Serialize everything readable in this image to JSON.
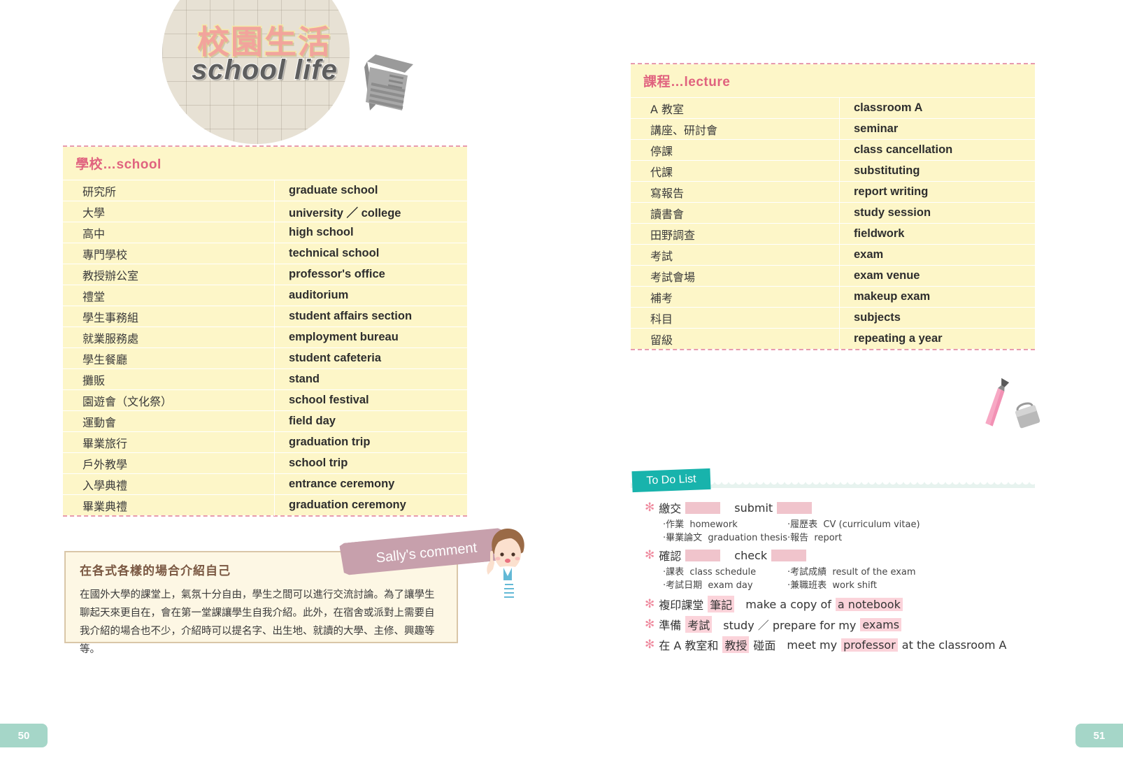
{
  "title": {
    "chinese": "校園生活",
    "english": "school life",
    "notebook_icon": "notebook-icon"
  },
  "tables": [
    {
      "id": "school",
      "title": "學校…school",
      "rows": [
        {
          "cn": "研究所",
          "en": "graduate school"
        },
        {
          "cn": "大學",
          "en": "university ／ college"
        },
        {
          "cn": "高中",
          "en": "high school"
        },
        {
          "cn": "專門學校",
          "en": "technical school"
        },
        {
          "cn": "教授辦公室",
          "en": "professor's office"
        },
        {
          "cn": "禮堂",
          "en": "auditorium"
        },
        {
          "cn": "學生事務組",
          "en": "student affairs section"
        },
        {
          "cn": "就業服務處",
          "en": "employment bureau"
        },
        {
          "cn": "學生餐廳",
          "en": "student cafeteria"
        },
        {
          "cn": "攤販",
          "en": "stand"
        },
        {
          "cn": "園遊會（文化祭）",
          "en": "school festival"
        },
        {
          "cn": "運動會",
          "en": "field day"
        },
        {
          "cn": "畢業旅行",
          "en": "graduation trip"
        },
        {
          "cn": "戶外教學",
          "en": "school trip"
        },
        {
          "cn": "入學典禮",
          "en": "entrance ceremony"
        },
        {
          "cn": "畢業典禮",
          "en": "graduation ceremony"
        }
      ]
    },
    {
      "id": "lecture",
      "title": "課程…lecture",
      "rows": [
        {
          "cn": "A 教室",
          "en": "classroom A"
        },
        {
          "cn": "講座、研討會",
          "en": "seminar"
        },
        {
          "cn": "停課",
          "en": "class cancellation"
        },
        {
          "cn": "代課",
          "en": "substituting"
        },
        {
          "cn": "寫報告",
          "en": "report writing"
        },
        {
          "cn": "讀書會",
          "en": "study session"
        },
        {
          "cn": "田野調查",
          "en": "fieldwork"
        },
        {
          "cn": "考試",
          "en": "exam"
        },
        {
          "cn": "考試會場",
          "en": "exam venue"
        },
        {
          "cn": "補考",
          "en": "makeup exam"
        },
        {
          "cn": "科目",
          "en": "subjects"
        },
        {
          "cn": "留級",
          "en": "repeating a year"
        }
      ]
    }
  ],
  "sally": {
    "tab_label": "Sally's comment",
    "heading": "在各式各樣的場合介紹自己",
    "body": "在國外大學的課堂上，氣氛十分自由，學生之間可以進行交流討論。為了讓學生聊起天來更自在，會在第一堂課讓學生自我介紹。此外，在宿舍或派對上需要自我介紹的場合也不少，介紹時可以提名字、出生地、就讀的大學、主修、興趣等等。"
  },
  "todo": {
    "tab_label": "To Do List",
    "items": [
      {
        "star": "✻",
        "cn_prefix": "繳交",
        "cn_blank": true,
        "en_text": "submit",
        "en_blank": true,
        "subs_left": [
          {
            "cn": "作業",
            "en": "homework"
          },
          {
            "cn": "畢業論文",
            "en": "graduation thesis"
          }
        ],
        "subs_right": [
          {
            "cn": "履歷表",
            "en": "CV (curriculum vitae)"
          },
          {
            "cn": "報告",
            "en": "report"
          }
        ]
      },
      {
        "star": "✻",
        "cn_prefix": "確認",
        "cn_blank": true,
        "en_text": "check",
        "en_blank": true,
        "subs_left": [
          {
            "cn": "課表",
            "en": "class schedule"
          },
          {
            "cn": "考試日期",
            "en": "exam day"
          }
        ],
        "subs_right": [
          {
            "cn": "考試成績",
            "en": "result of the exam"
          },
          {
            "cn": "兼職班表",
            "en": "work shift"
          }
        ]
      }
    ],
    "simple_items": [
      {
        "star": "✻",
        "cn_pre": "複印課堂",
        "cn_hl": "筆記",
        "cn_post": "",
        "en_pre": "make a copy of",
        "en_hl": "a notebook",
        "en_post": ""
      },
      {
        "star": "✻",
        "cn_pre": "準備",
        "cn_hl": "考試",
        "cn_post": "",
        "en_pre": "study ／ prepare for my",
        "en_hl": "exams",
        "en_post": ""
      },
      {
        "star": "✻",
        "cn_pre": "在 A 教室和",
        "cn_hl": "教授",
        "cn_post": "碰面",
        "en_pre": "meet my",
        "en_hl": "professor",
        "en_post": "at the classroom A"
      }
    ]
  },
  "pages": {
    "left": "50",
    "right": "51"
  },
  "colors": {
    "table_bg": "#fdf6c8",
    "table_dash": "#e79aae",
    "table_title": "#e0637f",
    "todo_tab": "#18b3ac",
    "todo_bg": "#e7f3ef",
    "highlight": "#fbd3da",
    "sally_tab": "#c7a0ac",
    "sally_bg": "#fdf7e4",
    "pagenum_bg": "#a5d6c8",
    "title_cn": "#f2a49c"
  }
}
